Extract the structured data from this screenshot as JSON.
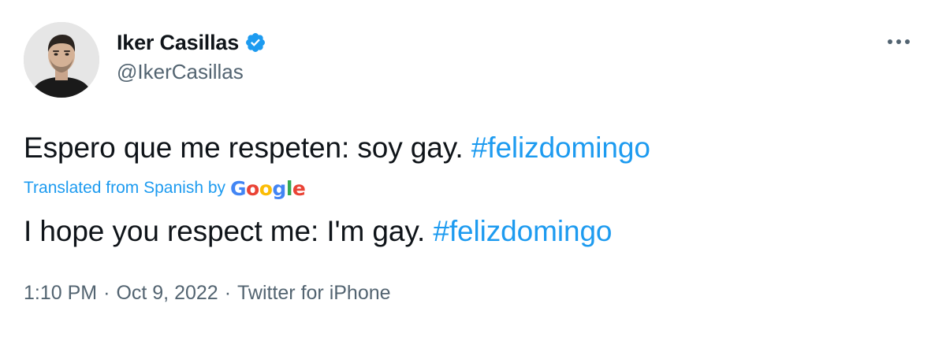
{
  "author": {
    "display_name": "Iker Casillas",
    "handle": "@IkerCasillas",
    "verified": true
  },
  "tweet": {
    "original_text": "Espero que me respeten: soy gay.",
    "original_hashtag": "#felizdomingo",
    "translation_label": "Translated from Spanish by",
    "translation_provider": "Google",
    "translated_text": "I hope you respect me: I'm gay.",
    "translated_hashtag": "#felizdomingo"
  },
  "meta": {
    "time": "1:10 PM",
    "separator": "·",
    "date": "Oct 9, 2022",
    "source": "Twitter for iPhone"
  },
  "icons": {
    "verified": "verified-badge-icon",
    "more": "more-options-icon"
  },
  "colors": {
    "link_blue": "#1d9bf0",
    "text_primary": "#0f1419",
    "text_secondary": "#536471"
  }
}
